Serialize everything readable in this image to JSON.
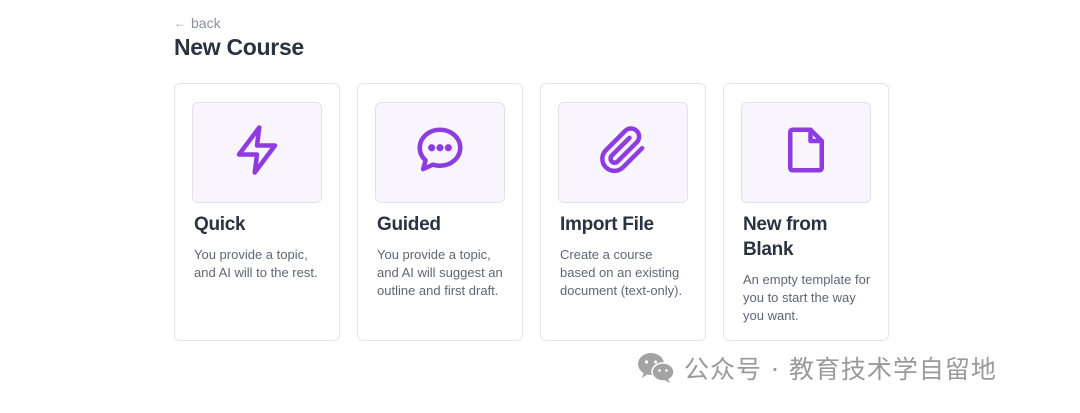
{
  "header": {
    "back_label": "back",
    "title": "New Course"
  },
  "cards": [
    {
      "title": "Quick",
      "description": "You provide a topic, and AI will to the rest.",
      "icon": "lightning-icon"
    },
    {
      "title": "Guided",
      "description": "You provide a topic, and AI will suggest an outline and first draft.",
      "icon": "chat-bubble-icon"
    },
    {
      "title": "Import File",
      "description": "Create a course based on an existing document (text-only).",
      "icon": "paperclip-icon"
    },
    {
      "title": "New from Blank",
      "description": "An empty template for you to start the way you want.",
      "icon": "document-icon"
    }
  ],
  "watermark": {
    "text": "公众号 · 教育技术学自留地",
    "icon": "wechat-icon"
  },
  "colors": {
    "accent": "#8e3ce0",
    "icon_box_bg": "#f8f5fe",
    "border": "#e3e5ea"
  }
}
